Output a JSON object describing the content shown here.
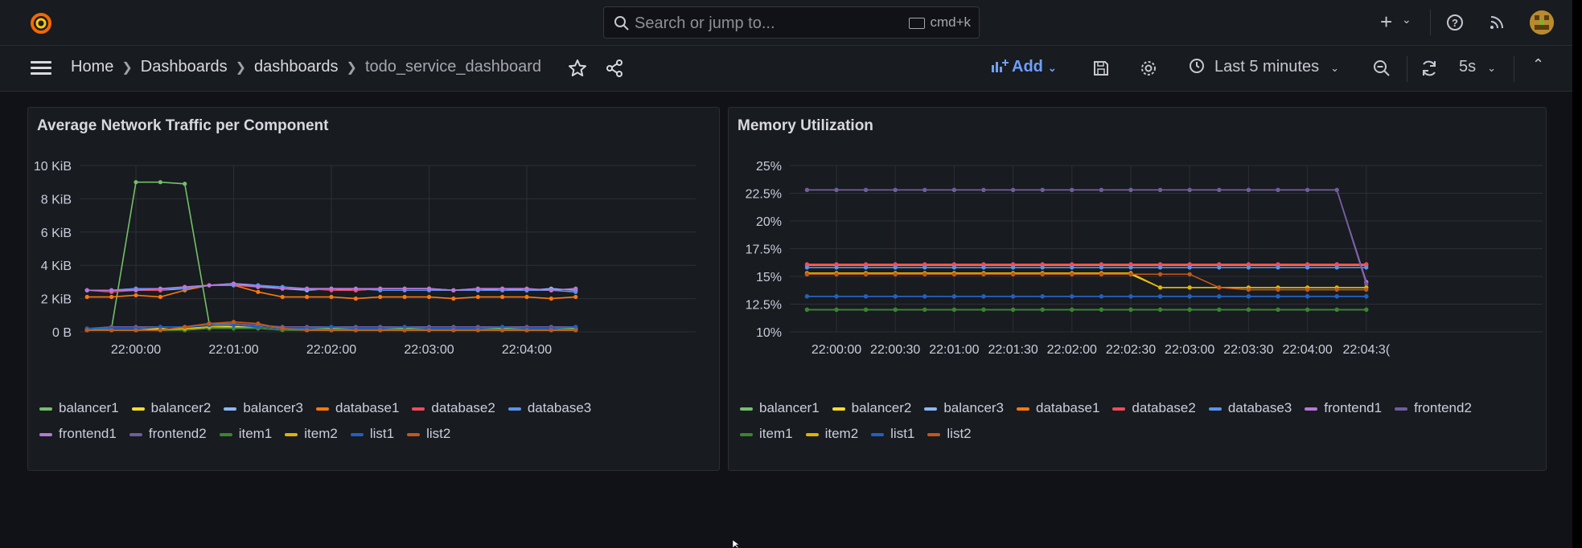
{
  "topbar": {
    "search_placeholder": "Search or jump to...",
    "shortcut": "cmd+k",
    "icons": [
      "grafana-logo-icon",
      "search-icon",
      "keyboard-icon",
      "plus-icon",
      "chevron-down-icon",
      "help-icon",
      "rss-icon",
      "avatar"
    ]
  },
  "navbar": {
    "breadcrumbs": [
      "Home",
      "Dashboards",
      "dashboards",
      "todo_service_dashboard"
    ],
    "add_label": "Add",
    "time_range": "Last 5 minutes",
    "refresh_interval": "5s"
  },
  "colors": {
    "balancer1": "#73bf69",
    "balancer2": "#fade2a",
    "balancer3": "#8ab8ff",
    "database1": "#ff780a",
    "database2": "#f2495c",
    "database3": "#5794f2",
    "frontend1": "#b877d9",
    "frontend2": "#705da0",
    "item1": "#37872d",
    "item2": "#e0b400",
    "list1": "#1f60c4",
    "list2": "#c4571c"
  },
  "panels": [
    {
      "title": "Average Network Traffic per Component",
      "legend_rows": [
        [
          "balancer1",
          "balancer2",
          "balancer3",
          "database1",
          "database2",
          "database3"
        ],
        [
          "frontend1",
          "frontend2",
          "item1",
          "item2",
          "list1",
          "list2"
        ]
      ]
    },
    {
      "title": "Memory Utilization",
      "legend_rows": [
        [
          "balancer1",
          "balancer2",
          "balancer3",
          "database1",
          "database2",
          "database3",
          "frontend1",
          "frontend2"
        ],
        [
          "item1",
          "item2",
          "list1",
          "list2"
        ]
      ]
    }
  ],
  "chart_data": [
    {
      "type": "line",
      "title": "Average Network Traffic per Component",
      "xlabel": "",
      "ylabel": "",
      "y_ticks": [
        "0 B",
        "2 KiB",
        "4 KiB",
        "6 KiB",
        "8 KiB",
        "10 KiB"
      ],
      "ylim": [
        0,
        10
      ],
      "y_unit": "KiB",
      "x_ticks": [
        "22:00:00",
        "22:01:00",
        "22:02:00",
        "22:03:00",
        "22:04:00"
      ],
      "x": [
        "21:59:30",
        "21:59:45",
        "22:00:00",
        "22:00:15",
        "22:00:30",
        "22:00:45",
        "22:01:00",
        "22:01:15",
        "22:01:30",
        "22:01:45",
        "22:02:00",
        "22:02:15",
        "22:02:30",
        "22:02:45",
        "22:03:00",
        "22:03:15",
        "22:03:30",
        "22:03:45",
        "22:04:00",
        "22:04:15",
        "22:04:30"
      ],
      "grid": true,
      "legend_position": "bottom",
      "series": [
        {
          "name": "balancer1",
          "values": [
            0.1,
            0.2,
            9.0,
            9.0,
            8.9,
            0.5,
            0.4,
            0.3,
            0.2,
            0.2,
            0.2,
            0.2,
            0.2,
            0.2,
            0.2,
            0.2,
            0.2,
            0.2,
            0.2,
            0.2,
            0.2
          ]
        },
        {
          "name": "balancer2",
          "values": [
            0.1,
            0.1,
            0.1,
            0.2,
            0.1,
            0.3,
            0.3,
            0.3,
            0.2,
            0.1,
            0.1,
            0.1,
            0.1,
            0.1,
            0.1,
            0.1,
            0.1,
            0.1,
            0.1,
            0.1,
            0.1
          ]
        },
        {
          "name": "balancer3",
          "values": [
            2.5,
            2.5,
            2.6,
            2.5,
            2.6,
            2.8,
            2.9,
            2.8,
            2.6,
            2.5,
            2.6,
            2.5,
            2.6,
            2.6,
            2.6,
            2.5,
            2.5,
            2.6,
            2.5,
            2.6,
            2.5
          ]
        },
        {
          "name": "database1",
          "values": [
            2.1,
            2.1,
            2.2,
            2.1,
            2.5,
            2.8,
            2.8,
            2.4,
            2.1,
            2.1,
            2.1,
            2.0,
            2.1,
            2.1,
            2.1,
            2.0,
            2.1,
            2.1,
            2.1,
            2.0,
            2.1
          ]
        },
        {
          "name": "database2",
          "values": [
            2.5,
            2.4,
            2.5,
            2.5,
            2.7,
            2.8,
            2.8,
            2.7,
            2.6,
            2.6,
            2.5,
            2.5,
            2.6,
            2.6,
            2.6,
            2.5,
            2.6,
            2.6,
            2.6,
            2.5,
            2.6
          ]
        },
        {
          "name": "database3",
          "values": [
            2.5,
            2.5,
            2.6,
            2.6,
            2.6,
            2.8,
            2.8,
            2.8,
            2.7,
            2.6,
            2.6,
            2.6,
            2.5,
            2.5,
            2.5,
            2.5,
            2.5,
            2.5,
            2.5,
            2.5,
            2.4
          ]
        },
        {
          "name": "frontend1",
          "values": [
            2.5,
            2.5,
            2.5,
            2.6,
            2.7,
            2.8,
            2.9,
            2.7,
            2.6,
            2.6,
            2.6,
            2.6,
            2.6,
            2.6,
            2.6,
            2.5,
            2.6,
            2.6,
            2.6,
            2.5,
            2.6
          ]
        },
        {
          "name": "frontend2",
          "values": [
            0.2,
            0.3,
            0.3,
            0.3,
            0.3,
            0.5,
            0.5,
            0.4,
            0.3,
            0.3,
            0.3,
            0.3,
            0.3,
            0.3,
            0.3,
            0.3,
            0.3,
            0.3,
            0.3,
            0.3,
            0.3
          ]
        },
        {
          "name": "item1",
          "values": [
            0.1,
            0.1,
            0.1,
            0.1,
            0.1,
            0.2,
            0.2,
            0.2,
            0.1,
            0.1,
            0.1,
            0.1,
            0.1,
            0.1,
            0.1,
            0.1,
            0.1,
            0.1,
            0.1,
            0.1,
            0.1
          ]
        },
        {
          "name": "item2",
          "values": [
            0.1,
            0.1,
            0.1,
            0.1,
            0.2,
            0.3,
            0.4,
            0.3,
            0.2,
            0.1,
            0.1,
            0.1,
            0.1,
            0.1,
            0.1,
            0.1,
            0.1,
            0.1,
            0.1,
            0.1,
            0.1
          ]
        },
        {
          "name": "list1",
          "values": [
            0.2,
            0.2,
            0.2,
            0.3,
            0.3,
            0.4,
            0.4,
            0.3,
            0.2,
            0.2,
            0.3,
            0.2,
            0.2,
            0.3,
            0.2,
            0.2,
            0.2,
            0.3,
            0.2,
            0.2,
            0.3
          ]
        },
        {
          "name": "list2",
          "values": [
            0.1,
            0.1,
            0.1,
            0.1,
            0.3,
            0.5,
            0.6,
            0.5,
            0.2,
            0.1,
            0.1,
            0.1,
            0.1,
            0.1,
            0.1,
            0.1,
            0.1,
            0.1,
            0.1,
            0.1,
            0.1
          ]
        }
      ]
    },
    {
      "type": "line",
      "title": "Memory Utilization",
      "xlabel": "",
      "ylabel": "",
      "y_ticks": [
        "10%",
        "12.5%",
        "15%",
        "17.5%",
        "20%",
        "22.5%",
        "25%"
      ],
      "ylim": [
        10,
        25
      ],
      "y_unit": "%",
      "x_ticks": [
        "22:00:00",
        "22:00:30",
        "22:01:00",
        "22:01:30",
        "22:02:00",
        "22:02:30",
        "22:03:00",
        "22:03:30",
        "22:04:00",
        "22:04:3("
      ],
      "x": [
        "21:59:45",
        "22:00:00",
        "22:00:15",
        "22:00:30",
        "22:00:45",
        "22:01:00",
        "22:01:15",
        "22:01:30",
        "22:01:45",
        "22:02:00",
        "22:02:15",
        "22:02:30",
        "22:02:45",
        "22:03:00",
        "22:03:15",
        "22:03:30",
        "22:03:45",
        "22:04:00",
        "22:04:15",
        "22:04:30"
      ],
      "grid": true,
      "legend_position": "bottom",
      "series": [
        {
          "name": "balancer1",
          "values": [
            12.0,
            12.0,
            12.0,
            12.0,
            12.0,
            12.0,
            12.0,
            12.0,
            12.0,
            12.0,
            12.0,
            12.0,
            12.0,
            12.0,
            12.0,
            12.0,
            12.0,
            12.0,
            12.0,
            12.0
          ]
        },
        {
          "name": "balancer2",
          "values": [
            15.2,
            15.2,
            15.2,
            15.2,
            15.2,
            15.2,
            15.2,
            15.2,
            15.2,
            15.2,
            15.2,
            15.2,
            14.0,
            14.0,
            14.0,
            14.0,
            14.0,
            14.0,
            14.0,
            14.0
          ]
        },
        {
          "name": "balancer3",
          "values": [
            13.2,
            13.2,
            13.2,
            13.2,
            13.2,
            13.2,
            13.2,
            13.2,
            13.2,
            13.2,
            13.2,
            13.2,
            13.2,
            13.2,
            13.2,
            13.2,
            13.2,
            13.2,
            13.2,
            13.2
          ]
        },
        {
          "name": "database1",
          "values": [
            16.0,
            16.0,
            16.0,
            16.0,
            16.0,
            16.0,
            16.0,
            16.0,
            16.0,
            16.0,
            16.0,
            16.0,
            16.0,
            16.0,
            16.0,
            16.0,
            16.0,
            16.0,
            16.0,
            16.0
          ]
        },
        {
          "name": "database2",
          "values": [
            16.1,
            16.1,
            16.1,
            16.1,
            16.1,
            16.1,
            16.1,
            16.1,
            16.1,
            16.1,
            16.1,
            16.1,
            16.1,
            16.1,
            16.1,
            16.1,
            16.1,
            16.1,
            16.1,
            16.1
          ]
        },
        {
          "name": "database3",
          "values": [
            15.8,
            15.8,
            15.8,
            15.8,
            15.8,
            15.8,
            15.8,
            15.8,
            15.8,
            15.8,
            15.8,
            15.8,
            15.8,
            15.8,
            15.8,
            15.8,
            15.8,
            15.8,
            15.8,
            15.8
          ]
        },
        {
          "name": "frontend1",
          "values": [
            22.8,
            22.8,
            22.8,
            22.8,
            22.8,
            22.8,
            22.8,
            22.8,
            22.8,
            22.8,
            22.8,
            22.8,
            22.8,
            22.8,
            22.8,
            22.8,
            22.8,
            22.8,
            22.8,
            14.5
          ]
        },
        {
          "name": "frontend2",
          "values": [
            22.8,
            22.8,
            22.8,
            22.8,
            22.8,
            22.8,
            22.8,
            22.8,
            22.8,
            22.8,
            22.8,
            22.8,
            22.8,
            22.8,
            22.8,
            22.8,
            22.8,
            22.8,
            22.8,
            14.3
          ]
        },
        {
          "name": "item1",
          "values": [
            12.0,
            12.0,
            12.0,
            12.0,
            12.0,
            12.0,
            12.0,
            12.0,
            12.0,
            12.0,
            12.0,
            12.0,
            12.0,
            12.0,
            12.0,
            12.0,
            12.0,
            12.0,
            12.0,
            12.0
          ]
        },
        {
          "name": "item2",
          "values": [
            15.3,
            15.3,
            15.3,
            15.3,
            15.3,
            15.3,
            15.3,
            15.3,
            15.3,
            15.3,
            15.3,
            15.3,
            14.0,
            14.0,
            14.0,
            14.0,
            14.0,
            14.0,
            14.0,
            14.0
          ]
        },
        {
          "name": "list1",
          "values": [
            13.2,
            13.2,
            13.2,
            13.2,
            13.2,
            13.2,
            13.2,
            13.2,
            13.2,
            13.2,
            13.2,
            13.2,
            13.2,
            13.2,
            13.2,
            13.2,
            13.2,
            13.2,
            13.2,
            13.2
          ]
        },
        {
          "name": "list2",
          "values": [
            15.2,
            15.2,
            15.2,
            15.2,
            15.2,
            15.2,
            15.2,
            15.2,
            15.2,
            15.2,
            15.2,
            15.2,
            15.2,
            15.2,
            14.0,
            13.8,
            13.8,
            13.8,
            13.8,
            13.8
          ]
        }
      ]
    }
  ]
}
